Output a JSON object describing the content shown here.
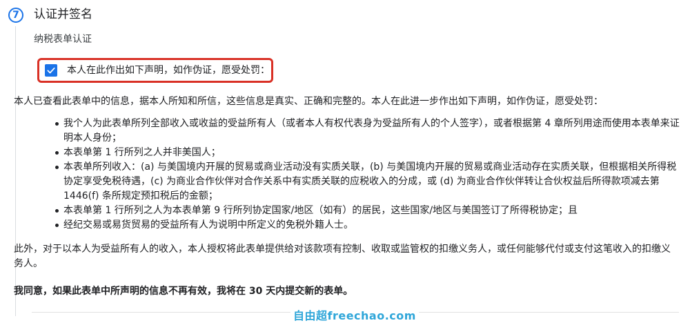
{
  "step": {
    "number": "7",
    "title": "认证并签名",
    "subtitle": "纳税表单认证"
  },
  "certification_checkbox": {
    "checked": true,
    "label": "本人在此作出如下声明，如作伪证，愿受处罚："
  },
  "declaration": {
    "intro": "本人已查看此表单中的信息，据本人所知和所信，这些信息是真实、正确和完整的。本人在此进一步作出如下声明，如作伪证，愿受处罚：",
    "items": [
      "我个人为此表单所列全部收入或收益的受益所有人（或者本人有权代表身为受益所有人的个人签字），或者根据第 4 章所列用途而使用本表单来证明本人身份；",
      "本表单第 1 行所列之人并非美国人；",
      "本表单所列收入：(a) 与美国境内开展的贸易或商业活动没有实质关联，(b) 与美国境内开展的贸易或商业活动存在实质关联，但根据相关所得税协定享受免税待遇，(c) 为商业合作伙伴对合作关系中有实质关联的应税收入的分成，或 (d) 为商业合作伙伴转让合伙权益后所得款项减去第 1446(f) 条所规定预扣税后的金额；",
      "本表单第 1 行所列之人为本表单第 9 行所列协定国家/地区（如有）的居民，这些国家/地区与美国签订了所得税协定；且",
      "经纪交易或易货贸易的受益所有人为说明中所定义的免税外籍人士。"
    ],
    "authorization": "此外，对于以本人为受益所有人的收入，本人授权将此表单提供给对该款项有控制、收取或监管权的扣缴义务人，或任何能够代付或支付这笔收入的扣缴义务人。",
    "agreement": "我同意，如果此表单中所声明的信息不再有效，我将在 30 天内提交新的表单。"
  },
  "watermark": "自由超freechao.com",
  "colors": {
    "accent": "#1a73e8",
    "highlight_border": "#d93025",
    "watermark": "#2fa6d9"
  },
  "icons": {
    "checkbox": "check-icon"
  }
}
